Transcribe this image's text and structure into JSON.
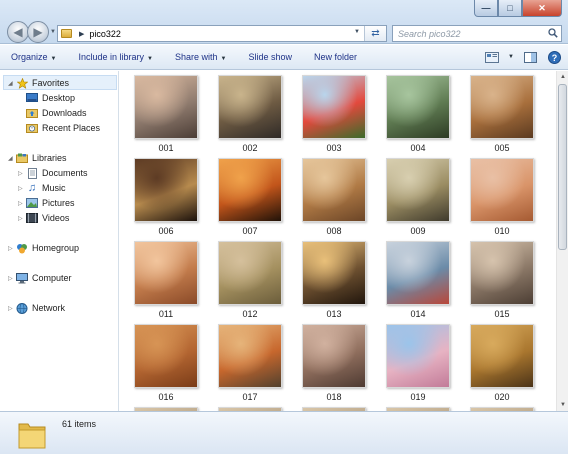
{
  "address": {
    "folder": "pico322"
  },
  "search": {
    "placeholder": "Search pico322"
  },
  "toolbar": {
    "organize": "Organize",
    "include": "Include in library",
    "share": "Share with",
    "slideshow": "Slide show",
    "newfolder": "New folder"
  },
  "nav": {
    "favorites": "Favorites",
    "desktop": "Desktop",
    "downloads": "Downloads",
    "recent": "Recent Places",
    "libraries": "Libraries",
    "documents": "Documents",
    "music": "Music",
    "pictures": "Pictures",
    "videos": "Videos",
    "homegroup": "Homegroup",
    "computer": "Computer",
    "network": "Network"
  },
  "files": [
    {
      "name": "001",
      "colors": [
        "#d9b9a0",
        "#8f7b6e",
        "#4b3d36"
      ]
    },
    {
      "name": "002",
      "colors": [
        "#c9b48c",
        "#6e5b43",
        "#2f2a27"
      ]
    },
    {
      "name": "003",
      "colors": [
        "#b9d5ec",
        "#e3493d",
        "#3b6b2a"
      ]
    },
    {
      "name": "004",
      "colors": [
        "#a7c59e",
        "#5f7b52",
        "#2d3b24"
      ]
    },
    {
      "name": "005",
      "colors": [
        "#d9b38b",
        "#a86f3c",
        "#5b3a20"
      ]
    },
    {
      "name": "006",
      "colors": [
        "#5d3b24",
        "#b78b4e",
        "#1c120c"
      ]
    },
    {
      "name": "007",
      "colors": [
        "#f0a24b",
        "#c2551b",
        "#201208"
      ]
    },
    {
      "name": "008",
      "colors": [
        "#e6c69b",
        "#b07a45",
        "#6b4527"
      ]
    },
    {
      "name": "009",
      "colors": [
        "#d8cfb0",
        "#9a8c62",
        "#3f3a2c"
      ]
    },
    {
      "name": "010",
      "colors": [
        "#e9c0a5",
        "#d99469",
        "#a55a32"
      ]
    },
    {
      "name": "011",
      "colors": [
        "#f2c59d",
        "#c37c4c",
        "#8a4a28"
      ]
    },
    {
      "name": "012",
      "colors": [
        "#d5c09c",
        "#a4905f",
        "#6b5d3b"
      ]
    },
    {
      "name": "013",
      "colors": [
        "#e9c07a",
        "#6d5030",
        "#21160d"
      ]
    },
    {
      "name": "014",
      "colors": [
        "#c8d2dd",
        "#6b8ba8",
        "#b9473a"
      ]
    },
    {
      "name": "015",
      "colors": [
        "#d6c3ad",
        "#8a7766",
        "#4c3e34"
      ]
    },
    {
      "name": "016",
      "colors": [
        "#d79455",
        "#b36531",
        "#7a3c18"
      ]
    },
    {
      "name": "017",
      "colors": [
        "#e6b47a",
        "#c7672d",
        "#52412e"
      ]
    },
    {
      "name": "018",
      "colors": [
        "#d1b19f",
        "#8f6e5d",
        "#4e3a32"
      ]
    },
    {
      "name": "019",
      "colors": [
        "#9bc4ea",
        "#e7b3c3",
        "#c27b98"
      ]
    },
    {
      "name": "020",
      "colors": [
        "#d8aa5d",
        "#a9762e",
        "#4b3318"
      ]
    }
  ],
  "details": {
    "count": "61 items"
  }
}
